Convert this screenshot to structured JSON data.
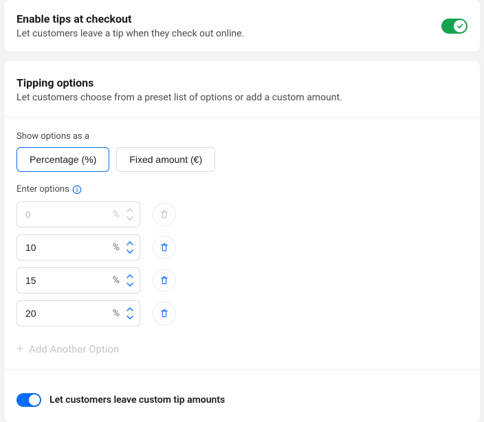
{
  "enable_tips": {
    "title": "Enable tips at checkout",
    "subtitle": "Let customers leave a tip when they check out online."
  },
  "tipping": {
    "title": "Tipping options",
    "subtitle": "Let customers choose from a preset list of options or add a custom amount.",
    "show_label": "Show options as a",
    "modes": {
      "percentage": "Percentage (%)",
      "fixed": "Fixed amount (€)"
    },
    "enter_label": "Enter options",
    "suffix": "%",
    "options": [
      {
        "value": "",
        "placeholder": "0",
        "disabled": true
      },
      {
        "value": "10",
        "placeholder": "",
        "disabled": false
      },
      {
        "value": "15",
        "placeholder": "",
        "disabled": false
      },
      {
        "value": "20",
        "placeholder": "",
        "disabled": false
      }
    ],
    "add_label": "Add Another Option",
    "custom_label": "Let customers leave custom tip amounts"
  }
}
